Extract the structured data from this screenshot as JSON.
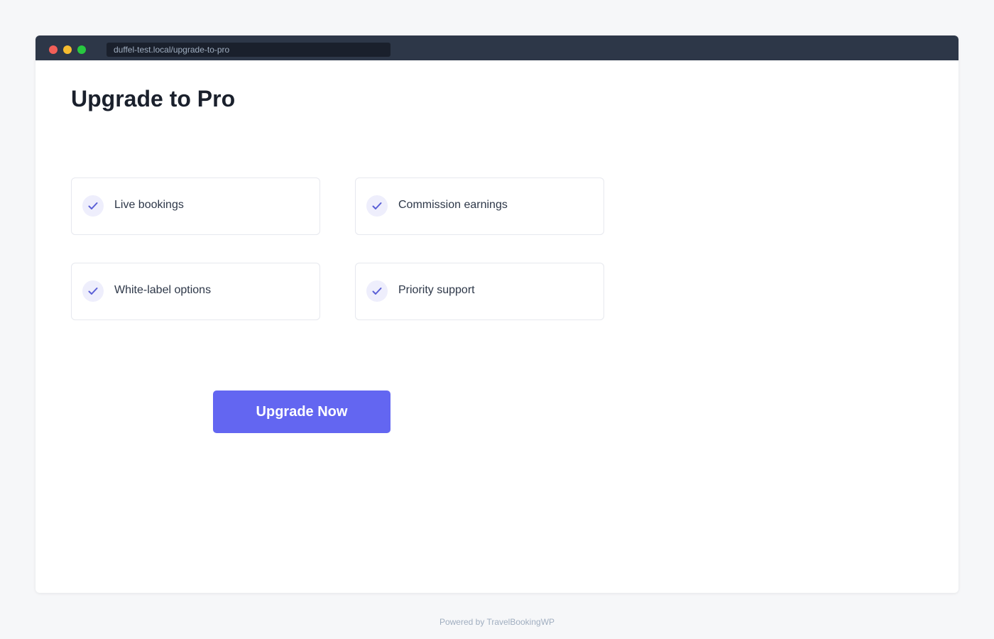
{
  "browser": {
    "url": "duffel-test.local/upgrade-to-pro"
  },
  "page": {
    "title": "Upgrade to Pro"
  },
  "features": [
    {
      "label": "Live bookings",
      "icon": "check-icon"
    },
    {
      "label": "Commission earnings",
      "icon": "check-icon"
    },
    {
      "label": "White-label options",
      "icon": "check-icon"
    },
    {
      "label": "Priority support",
      "icon": "check-icon"
    }
  ],
  "cta": {
    "label": "Upgrade Now"
  },
  "footer": {
    "text": "Powered by TravelBookingWP"
  },
  "colors": {
    "accent": "#6366f1",
    "titlebar": "#2d3748",
    "check_bg": "#eeeefc"
  }
}
